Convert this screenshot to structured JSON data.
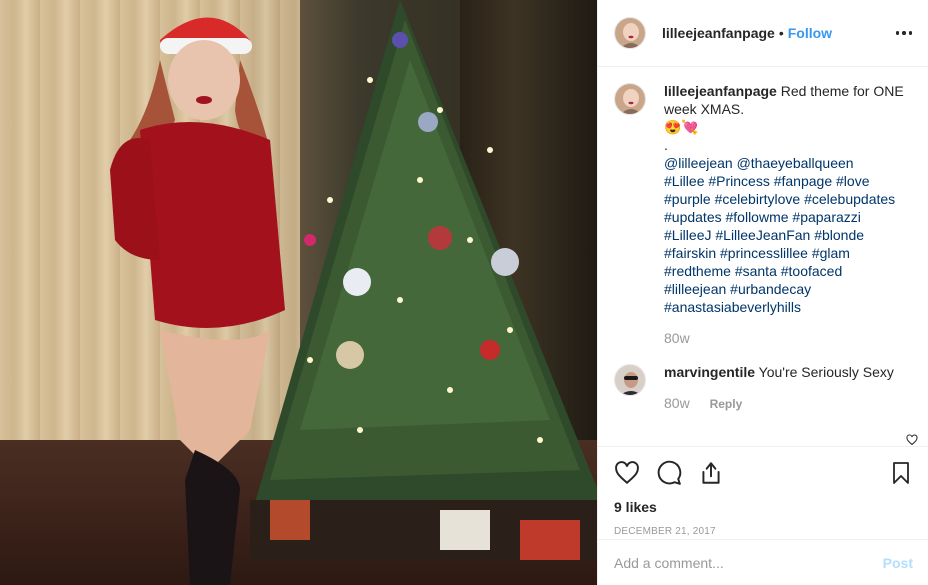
{
  "post": {
    "username": "lilleejeanfanpage",
    "follow_label": "Follow",
    "separator": "•"
  },
  "caption": {
    "username": "lilleejeanfanpage",
    "text": "Red theme for ONE week XMAS.",
    "emoji": "😍💘",
    "dot": ".",
    "tag_lines": [
      "@lilleejean @thaeyeballqueen",
      "#Lillee #Princess #fanpage #love",
      "#purple #celebirtylove #celebupdates",
      "#updates #followme #paparazzi",
      "#LilleeJ #LilleeJeanFan #blonde",
      "#fairskin #princesslillee #glam",
      "#redtheme #santa #toofaced",
      "#lilleejean #urbandecay",
      "#anastasiabeverlyhills"
    ],
    "time": "80w"
  },
  "comment": {
    "username": "marvingentile",
    "text": "You're Seriously Sexy",
    "time": "80w",
    "reply_label": "Reply"
  },
  "stats": {
    "likes": "9 likes",
    "date": "DECEMBER 21, 2017"
  },
  "add_comment": {
    "placeholder": "Add a comment...",
    "post_label": "Post"
  },
  "icons": {
    "like": "heart-icon",
    "comment": "comment-icon",
    "share": "share-icon",
    "save": "bookmark-icon",
    "more": "more-options-icon"
  },
  "colors": {
    "link": "#003569",
    "follow": "#3897f0",
    "muted": "#999999",
    "post_disabled": "#b2dffc"
  }
}
